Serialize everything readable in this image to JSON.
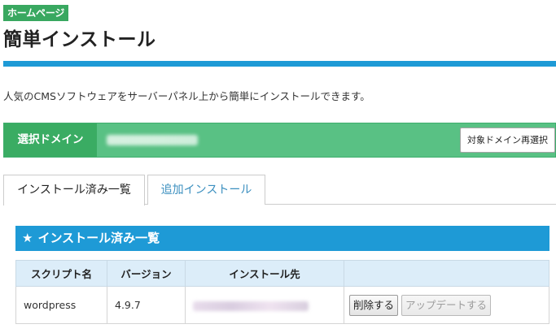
{
  "header": {
    "home_badge": "ホームページ",
    "title": "簡単インストール",
    "description": "人気のCMSソフトウェアをサーバーパネル上から簡単にインストールできます。"
  },
  "domain": {
    "label": "選択ドメイン",
    "reselect_button": "対象ドメイン再選択"
  },
  "tabs": [
    {
      "label": "インストール済み一覧",
      "active": true
    },
    {
      "label": "追加インストール",
      "active": false
    }
  ],
  "panel": {
    "star": "★",
    "title": "インストール済み一覧"
  },
  "table": {
    "headers": [
      "スクリプト名",
      "バージョン",
      "インストール先",
      ""
    ],
    "rows": [
      {
        "script": "wordpress",
        "version": "4.9.7",
        "delete_button": "削除する",
        "update_button": "アップデートする"
      }
    ]
  },
  "colors": {
    "accent_blue": "#1e9ad6",
    "domain_green": "#59c184",
    "badge_green": "#39a860"
  }
}
